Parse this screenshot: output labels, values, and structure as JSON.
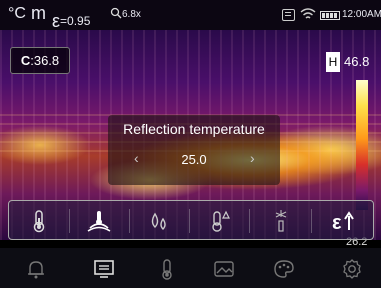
{
  "status": {
    "unit": "°C",
    "mode": "m",
    "emissivity_symbol": "ε",
    "emissivity_value": "=0.95",
    "zoom": "6.8x",
    "time": "12:00AM"
  },
  "readouts": {
    "center_label": "C",
    "center_value": ":36.8",
    "high_label": "H",
    "high_value": "46.8",
    "low_label": "26.2"
  },
  "popup": {
    "title": "Reflection temperature",
    "value": "25.0",
    "left_arrow": "‹",
    "right_arrow": "›"
  },
  "toolbar": {
    "items": [
      "thermometer-icon",
      "emitter-icon",
      "humidity-icon",
      "temperature-delta-icon",
      "laser-icon",
      "emissivity-icon"
    ]
  },
  "nav": {
    "items": [
      "bell-icon",
      "screen-icon",
      "thermometer-icon",
      "image-icon",
      "palette-icon",
      "settings-icon"
    ]
  }
}
